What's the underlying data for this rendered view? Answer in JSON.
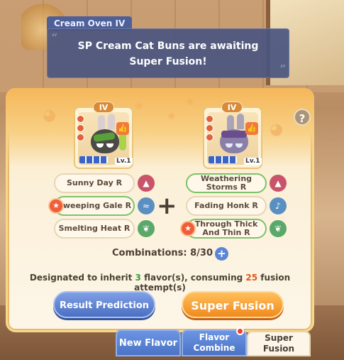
{
  "dialog": {
    "speaker": "Cream Oven IV",
    "quote_open": "“",
    "quote_close": "”",
    "line1": "SP Cream Cat Buns are awaiting",
    "line2": "Super Fusion!"
  },
  "help_icon": "?",
  "left_card": {
    "tier": "IV",
    "level": "Lv.1",
    "flavors": [
      {
        "label": "Sunny Day R",
        "selected": false,
        "icon": "mountain-icon",
        "icon_color": "#c9546a"
      },
      {
        "label": "Sweeping Gale R",
        "selected": true,
        "icon": "wind-icon",
        "icon_color": "#5a8fc2"
      },
      {
        "label": "Smelting Heat R",
        "selected": false,
        "icon": "leaf-icon",
        "icon_color": "#5aa96a"
      }
    ]
  },
  "right_card": {
    "tier": "IV",
    "level": "Lv.1",
    "flavors": [
      {
        "label": "Weathering Storms R",
        "selected": true,
        "icon": "mountain-icon",
        "icon_color": "#c9546a"
      },
      {
        "label": "Fading Honk R",
        "selected": false,
        "icon": "bell-icon",
        "icon_color": "#5a8fc2"
      },
      {
        "label": "Through Thick And Thin R",
        "selected": true,
        "icon": "leaf-icon",
        "icon_color": "#5aa96a"
      }
    ]
  },
  "plus_sign": "+",
  "combinations": {
    "label": "Combinations: 8/30",
    "add": "+"
  },
  "inherit": {
    "prefix": "Designated to inherit ",
    "count": "3",
    "middle": " flavor(s), consuming ",
    "attempts": "25",
    "suffix": " fusion attempt(s)"
  },
  "buttons": {
    "prediction": "Result Prediction",
    "fusion": "Super Fusion"
  },
  "tabs": {
    "new_flavor": "New Flavor",
    "flavor_combine_line1": "Flavor",
    "flavor_combine_line2": "Combine",
    "super_fusion": "Super Fusion"
  },
  "colors": {
    "accent_orange": "#f08a1e",
    "accent_blue": "#4b6fc2",
    "selected_green": "#7cc36a"
  }
}
